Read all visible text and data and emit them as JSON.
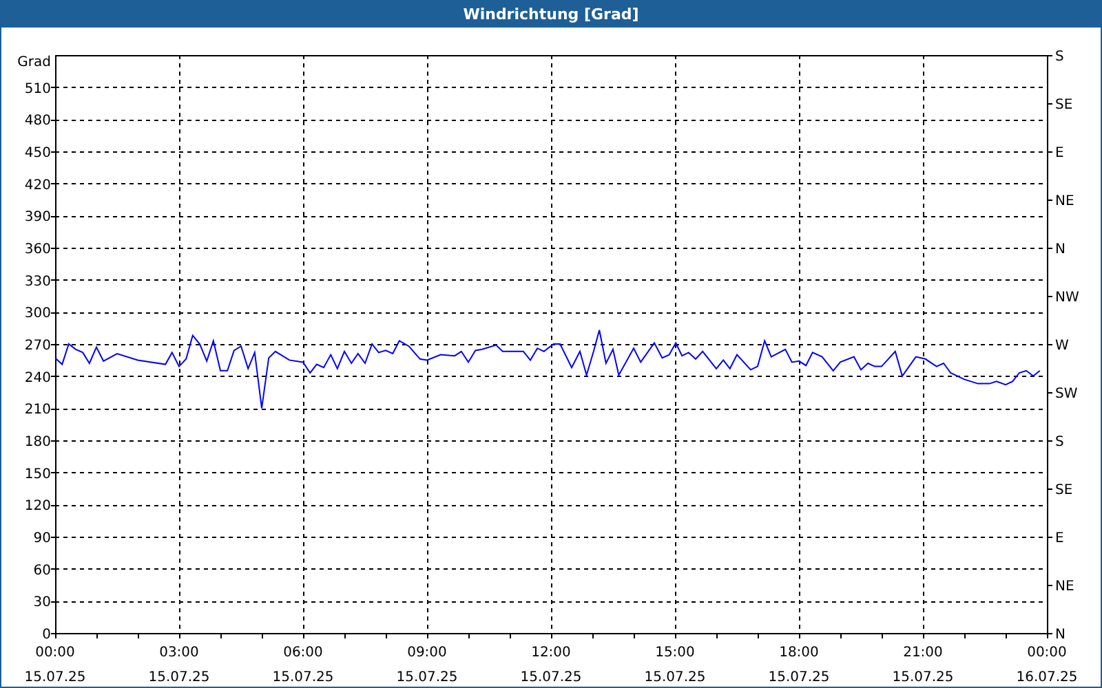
{
  "window": {
    "title": "Windrichtung [Grad]"
  },
  "chart": {
    "chart_data": {
      "type": "line",
      "ylabel": "Grad",
      "xlim": [
        0,
        24
      ],
      "ylim": [
        0,
        540
      ],
      "grid": true,
      "xticks": [
        {
          "value": 0,
          "label": "00:00"
        },
        {
          "value": 3,
          "label": "03:00"
        },
        {
          "value": 6,
          "label": "06:00"
        },
        {
          "value": 9,
          "label": "09:00"
        },
        {
          "value": 12,
          "label": "12:00"
        },
        {
          "value": 15,
          "label": "15:00"
        },
        {
          "value": 18,
          "label": "18:00"
        },
        {
          "value": 21,
          "label": "21:00"
        },
        {
          "value": 24,
          "label": "00:00"
        }
      ],
      "yticks": [
        0,
        30,
        60,
        90,
        120,
        150,
        180,
        210,
        240,
        270,
        300,
        330,
        360,
        390,
        420,
        450,
        480,
        510
      ],
      "x": [
        0,
        0.17,
        0.33,
        0.5,
        0.67,
        0.83,
        1.0,
        1.17,
        1.5,
        2.0,
        2.67,
        2.83,
        3.0,
        3.17,
        3.33,
        3.5,
        3.67,
        3.83,
        4.0,
        4.17,
        4.33,
        4.5,
        4.67,
        4.83,
        5.0,
        5.17,
        5.33,
        5.67,
        6.0,
        6.17,
        6.33,
        6.5,
        6.67,
        6.83,
        7.0,
        7.17,
        7.33,
        7.5,
        7.67,
        7.83,
        8.0,
        8.17,
        8.33,
        8.56,
        8.83,
        9.0,
        9.33,
        9.67,
        9.83,
        10.0,
        10.17,
        10.33,
        10.67,
        10.83,
        11.33,
        11.5,
        11.67,
        11.83,
        12.06,
        12.22,
        12.5,
        12.7,
        12.86,
        13.03,
        13.17,
        13.33,
        13.5,
        13.64,
        14.0,
        14.17,
        14.5,
        14.69,
        14.86,
        15.02,
        15.17,
        15.33,
        15.5,
        15.67,
        16.0,
        16.17,
        16.33,
        16.5,
        16.83,
        17.0,
        17.17,
        17.33,
        17.67,
        17.83,
        18.0,
        18.17,
        18.33,
        18.56,
        18.83,
        19.0,
        19.33,
        19.5,
        19.67,
        19.83,
        20.0,
        20.33,
        20.5,
        20.83,
        21.06,
        21.33,
        21.5,
        21.67,
        22.0,
        22.33,
        22.61,
        22.78,
        23.0,
        23.17,
        23.33,
        23.5,
        23.67,
        23.83
      ],
      "series": [
        {
          "color": "#0000ff",
          "values": [
            257,
            251,
            270,
            265,
            262,
            252,
            267,
            254,
            261,
            255,
            251,
            262,
            249,
            256,
            278,
            270,
            254,
            273,
            245,
            245,
            264,
            268,
            247,
            262,
            210,
            257,
            263,
            255,
            253,
            243,
            251,
            248,
            260,
            247,
            263,
            252,
            261,
            252,
            270,
            262,
            264,
            261,
            273,
            268,
            256,
            255,
            260,
            259,
            263,
            253,
            264,
            265,
            269,
            263,
            263,
            255,
            266,
            263,
            270,
            270,
            248,
            263,
            241,
            263,
            283,
            252,
            265,
            241,
            266,
            253,
            271,
            257,
            260,
            271,
            259,
            262,
            256,
            263,
            247,
            255,
            247,
            260,
            246,
            249,
            273,
            258,
            265,
            253,
            254,
            250,
            262,
            258,
            245,
            253,
            258,
            246,
            252,
            249,
            249,
            263,
            240,
            258,
            256,
            249,
            252,
            243,
            237,
            233,
            233,
            235,
            232,
            235,
            243,
            245,
            240,
            245
          ]
        }
      ]
    },
    "x_axis_dates": [
      "15.07.25",
      "15.07.25",
      "15.07.25",
      "15.07.25",
      "15.07.25",
      "15.07.25",
      "15.07.25",
      "15.07.25",
      "16.07.25"
    ],
    "right_axis_labels": [
      "S",
      "SE",
      "E",
      "NE",
      "N",
      "NW",
      "W",
      "SW",
      "S",
      "SE",
      "E",
      "NE",
      "N"
    ]
  }
}
